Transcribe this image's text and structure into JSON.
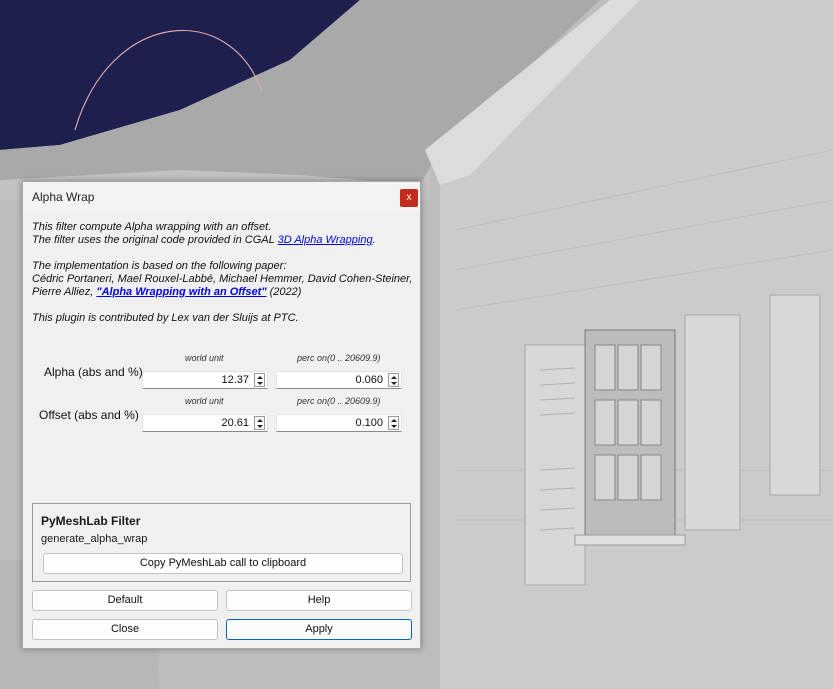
{
  "dialog": {
    "title": "Alpha Wrap",
    "close_label": "x",
    "description": {
      "line1": "This filter compute Alpha wrapping with an offset.",
      "line2_prefix": "The filter uses the original code provided in CGAL ",
      "line2_link": "3D Alpha Wrapping",
      "line2_suffix": ".",
      "line3": "The implementation is based on the following paper:",
      "line4": "Cédric Portaneri, Mael Rouxel-Labbé, Michael Hemmer, David Cohen-Steiner,",
      "line5_prefix": "Pierre Alliez, ",
      "line5_link": "\"Alpha Wrapping with an Offset\"",
      "line5_suffix": " (2022)",
      "line6": "This plugin is contributed by Lex van der Sluijs at PTC."
    },
    "params": [
      {
        "label": "Alpha (abs and %)",
        "col1_header": "world unit",
        "col1_value": "12.37",
        "col2_header": "perc on(0 .. 20609.9)",
        "col2_value": "0.060"
      },
      {
        "label": "Offset (abs and %)",
        "col1_header": "world unit",
        "col1_value": "20.61",
        "col2_header": "perc on(0 .. 20609.9)",
        "col2_value": "0.100"
      }
    ],
    "pymeshlab": {
      "title": "PyMeshLab Filter",
      "function_name": "generate_alpha_wrap",
      "copy_button": "Copy PyMeshLab call to clipboard"
    },
    "buttons": {
      "default": "Default",
      "help": "Help",
      "close": "Close",
      "apply": "Apply"
    }
  },
  "colors": {
    "sky": "#1e1f4e",
    "wall": "#cacaca",
    "close_button": "#c42b1c",
    "link": "#0000ee",
    "apply_border": "#0a64c8"
  }
}
